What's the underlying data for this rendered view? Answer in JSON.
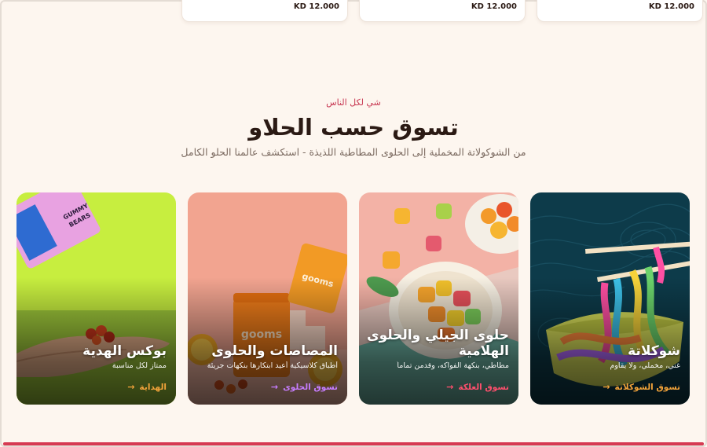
{
  "products": {
    "prices": [
      "KD 12.000",
      "KD 12.000",
      "KD 12.000"
    ]
  },
  "section": {
    "eyebrow": "شي لكل الناس",
    "title": "تسوق حسب الحلاو",
    "subtitle": "من الشوكولاتة المخملية إلى الحلوى المطاطية اللذيذة - استكشف عالمنا الحلو الكامل"
  },
  "cards": [
    {
      "title": "شوكلاتة",
      "desc": "غني، مخملي، ولا يقاوم",
      "cta": "تسوق الشوكلاتة",
      "accent": "#f2a33a"
    },
    {
      "title": "حلوى الجيلي والحلوى الهلامية",
      "desc": "مطاطي، بنكهة الفواكه، وقدمن تماماً",
      "cta": "تسوق العلكة",
      "accent": "#ff4f6d"
    },
    {
      "title": "المصاصات والحلوى",
      "desc": "أطباق كلاسيكية أعيد ابتكارها بنكهات جريئة",
      "cta": "تسوق الحلوى",
      "accent": "#c77dff"
    },
    {
      "title": "بوكس الهدية",
      "desc": "ممتاز لكل مناسبة",
      "cta": "الهداية",
      "accent": "#f2a33a"
    }
  ]
}
